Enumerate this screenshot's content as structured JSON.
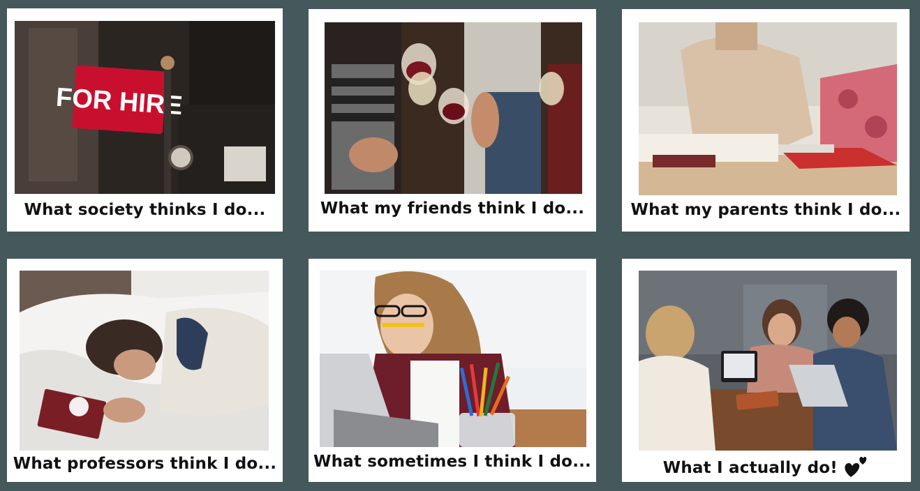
{
  "cards": [
    {
      "caption": "What society thinks I do...",
      "image_alt": "FOR HIRE"
    },
    {
      "caption": "What my friends think I do..."
    },
    {
      "caption": "What my parents think I do..."
    },
    {
      "caption": "What professors think I do..."
    },
    {
      "caption": "What sometimes I think I do..."
    },
    {
      "caption": "What I actually do!",
      "decoration": "hearts-icon"
    }
  ],
  "colors": {
    "background": "#45585b",
    "card": "#ffffff",
    "sign_red": "#c8102e"
  }
}
